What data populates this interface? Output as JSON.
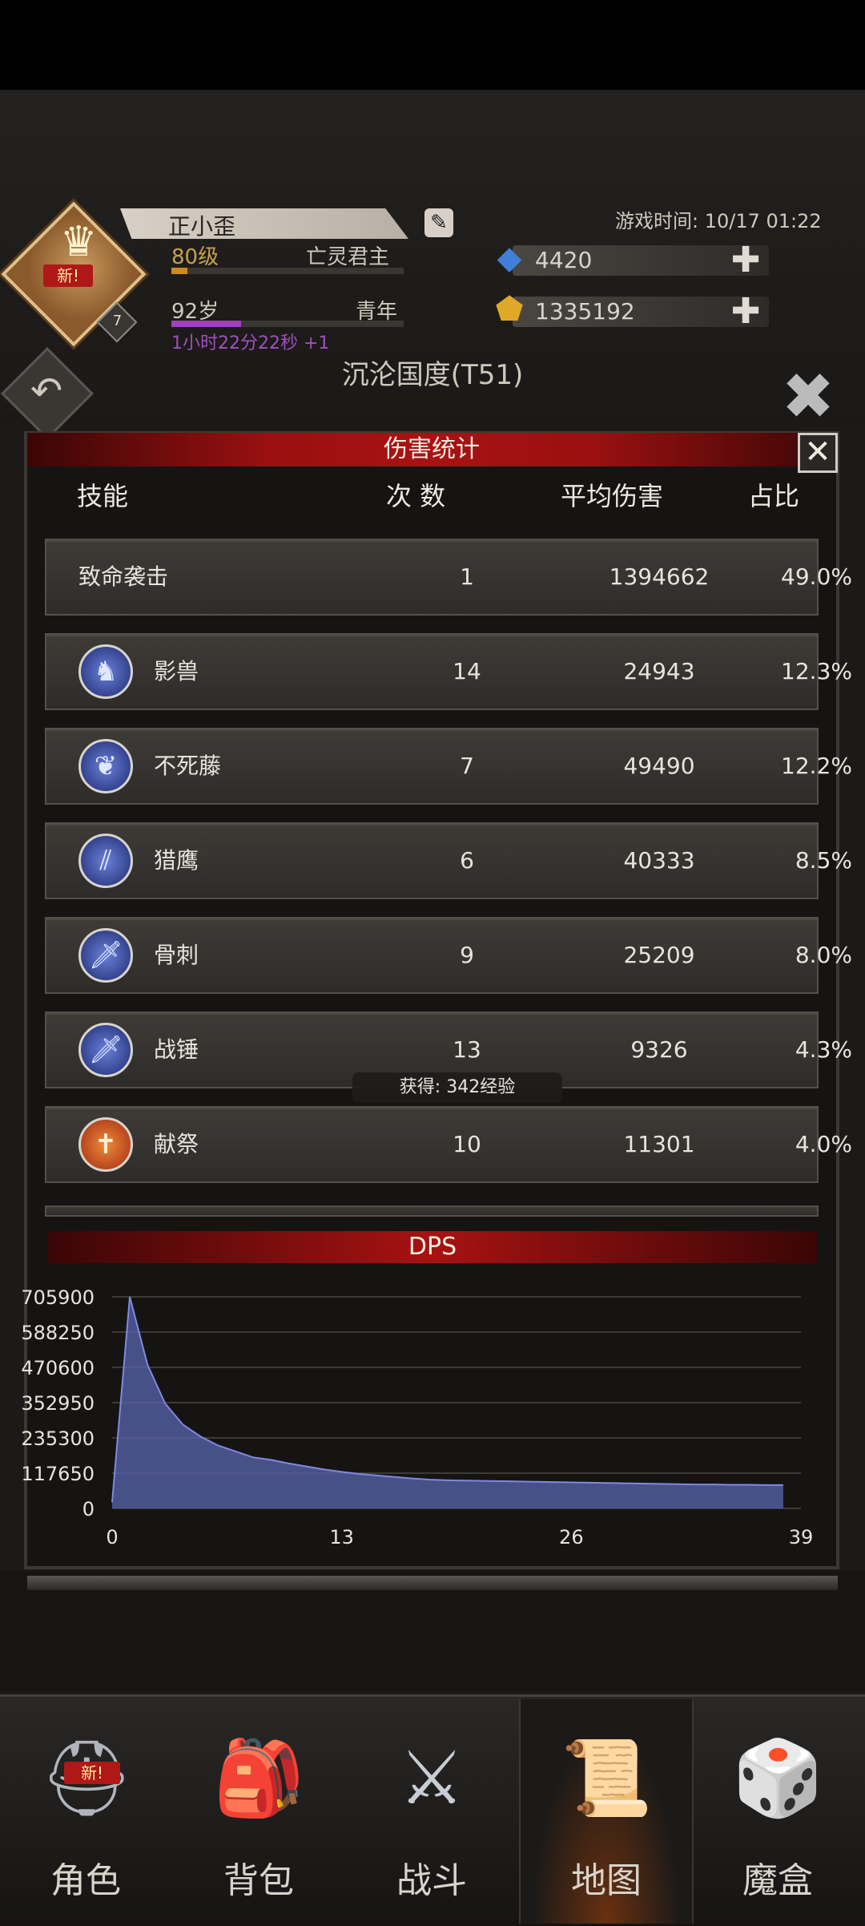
{
  "header": {
    "player_name": "正小歪",
    "level": "80级",
    "title": "亡灵君主",
    "level_progress": 0.07,
    "age": "92岁",
    "age_stage": "青年",
    "age_progress": 0.3,
    "time_gain": "1小时22分22秒 +1",
    "rank_badge_new": "新!",
    "rank_num": "7",
    "game_time": "游戏时间: 10/17 01:22",
    "diamonds": "4420",
    "gold": "1335192",
    "map_title": "沉沦国度(T51)"
  },
  "panel": {
    "title": "伤害统计",
    "close": "✕",
    "columns": {
      "skill": "技能",
      "count": "次 数",
      "avg": "平均伤害",
      "pct": "占比"
    },
    "rows": [
      {
        "skill": "致命袭击",
        "count": "1",
        "avg": "1394662",
        "pct": "49.0%",
        "icon": ""
      },
      {
        "skill": "影兽",
        "count": "14",
        "avg": "24943",
        "pct": "12.3%",
        "icon": "beast-icon"
      },
      {
        "skill": "不死藤",
        "count": "7",
        "avg": "49490",
        "pct": "12.2%",
        "icon": "vine-icon"
      },
      {
        "skill": "猎鹰",
        "count": "6",
        "avg": "40333",
        "pct": "8.5%",
        "icon": "claw-icon"
      },
      {
        "skill": "骨刺",
        "count": "9",
        "avg": "25209",
        "pct": "8.0%",
        "icon": "sword-icon"
      },
      {
        "skill": "战锤",
        "count": "13",
        "avg": "9326",
        "pct": "4.3%",
        "icon": "sword-icon"
      },
      {
        "skill": "献祭",
        "count": "10",
        "avg": "11301",
        "pct": "4.0%",
        "icon": "cross-icon"
      }
    ],
    "toast": "获得: 342经验"
  },
  "dps": {
    "title": "DPS",
    "y_ticks": [
      "705900",
      "588250",
      "470600",
      "352950",
      "235300",
      "117650",
      "0"
    ],
    "x_ticks": [
      "0",
      "13",
      "26",
      "39"
    ]
  },
  "chart_data": {
    "type": "area",
    "title": "DPS",
    "xlabel": "",
    "ylabel": "",
    "ylim": [
      0,
      705900
    ],
    "xlim": [
      0,
      39
    ],
    "grid": true,
    "color": "#5a64b0",
    "x": [
      0,
      1,
      2,
      3,
      4,
      5,
      6,
      7,
      8,
      9,
      10,
      11,
      12,
      13,
      14,
      15,
      16,
      17,
      18,
      19,
      20,
      21,
      22,
      23,
      24,
      25,
      26,
      27,
      28,
      29,
      30,
      31,
      32,
      33,
      34,
      35,
      36,
      37,
      38
    ],
    "values": [
      20000,
      705900,
      480000,
      350000,
      280000,
      240000,
      210000,
      190000,
      170000,
      162000,
      150000,
      140000,
      130000,
      122000,
      115000,
      110000,
      105000,
      100000,
      96000,
      94000,
      93000,
      92000,
      91000,
      90000,
      89000,
      88000,
      87000,
      86000,
      85000,
      84000,
      83000,
      82000,
      81000,
      80000,
      80000,
      79000,
      79000,
      78000,
      78000
    ]
  },
  "nav": [
    {
      "label": "角色",
      "icon": "helmet-icon",
      "glyph": "⛑",
      "badge": "新!"
    },
    {
      "label": "背包",
      "icon": "backpack-icon",
      "glyph": "🎒"
    },
    {
      "label": "战斗",
      "icon": "sword-shield-icon",
      "glyph": "⚔"
    },
    {
      "label": "地图",
      "icon": "scroll-map-icon",
      "glyph": "📜"
    },
    {
      "label": "魔盒",
      "icon": "magic-box-icon",
      "glyph": "🎲"
    }
  ],
  "icons": {
    "crown": "♛",
    "edit": "✎",
    "diamond": "◆",
    "gold": "⬟",
    "plus": "✚",
    "back": "↶",
    "exit": "✖"
  },
  "colors": {
    "accent_red": "#a81212",
    "area_fill": "#5a64b0",
    "gold": "#e0a828",
    "diamond": "#3f7fd8"
  }
}
